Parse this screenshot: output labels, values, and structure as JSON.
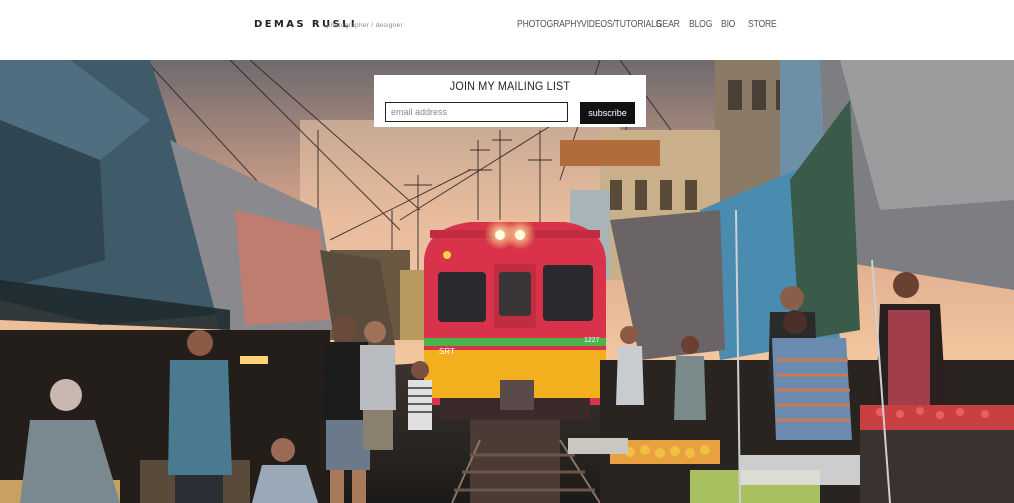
{
  "site": {
    "brand_name": "DEMAS RUSLI",
    "tagline": "photographer / designer"
  },
  "nav": {
    "items": [
      {
        "label": "PHOTOGRAPHY"
      },
      {
        "label": "VIDEOS/TUTORIALS"
      },
      {
        "label": "GEAR"
      },
      {
        "label": "BLOG"
      },
      {
        "label": "BIO"
      },
      {
        "label": "STORE"
      }
    ]
  },
  "mailing_list": {
    "title": "JOIN MY MAILING LIST",
    "email_placeholder": "email address",
    "subscribe_label": "subscribe"
  },
  "hero": {
    "train_number": "1227",
    "train_logo": "SRT"
  },
  "colors": {
    "header_bg": "#ffffff",
    "button_bg": "#111111",
    "train_red": "#d8334a",
    "train_yellow": "#f2b01e",
    "train_green": "#4bb54a"
  }
}
